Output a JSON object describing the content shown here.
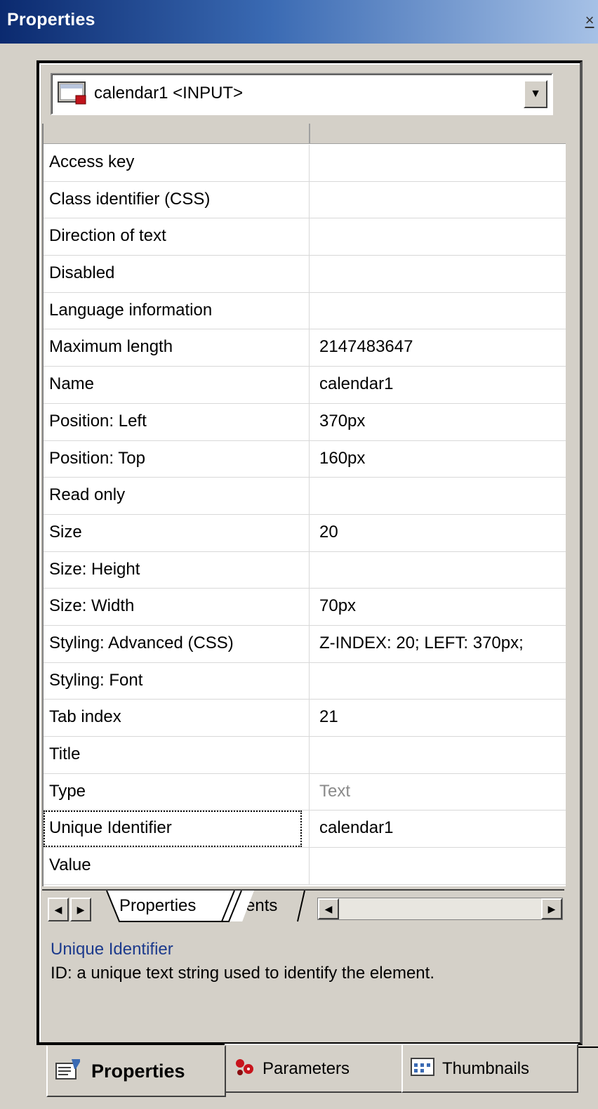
{
  "window": {
    "title": "Properties",
    "close_label": "×"
  },
  "object_selector": {
    "value": "calendar1 <INPUT>",
    "dropdown_arrow": "▼"
  },
  "properties": [
    {
      "name": "Access key",
      "value": ""
    },
    {
      "name": "Class identifier (CSS)",
      "value": ""
    },
    {
      "name": "Direction of text",
      "value": ""
    },
    {
      "name": "Disabled",
      "value": ""
    },
    {
      "name": "Language information",
      "value": ""
    },
    {
      "name": "Maximum length",
      "value": "2147483647"
    },
    {
      "name": "Name",
      "value": "calendar1"
    },
    {
      "name": "Position: Left",
      "value": "370px"
    },
    {
      "name": "Position: Top",
      "value": "160px"
    },
    {
      "name": "Read only",
      "value": ""
    },
    {
      "name": "Size",
      "value": "20"
    },
    {
      "name": "Size: Height",
      "value": ""
    },
    {
      "name": "Size: Width",
      "value": "70px"
    },
    {
      "name": "Styling: Advanced (CSS)",
      "value": "Z-INDEX: 20; LEFT: 370px;"
    },
    {
      "name": "Styling: Font",
      "value": ""
    },
    {
      "name": "Tab index",
      "value": "21"
    },
    {
      "name": "Title",
      "value": ""
    },
    {
      "name": "Type",
      "value": "Text"
    },
    {
      "name": "Unique Identifier",
      "value": "calendar1"
    },
    {
      "name": "Value",
      "value": ""
    }
  ],
  "focused_property": "Unique Identifier",
  "sheet_tabs": {
    "properties": "Properties",
    "events": "Events",
    "scroll_left": "◀",
    "scroll_right": "▶"
  },
  "description": {
    "title": "Unique Identifier",
    "text": "ID: a unique text string used to identify the element."
  },
  "bottom_tabs": {
    "properties": "Properties",
    "parameters": "Parameters",
    "thumbnails": "Thumbnails",
    "active": "properties"
  },
  "colors": {
    "titlebar_start": "#0b2a6f",
    "titlebar_end": "#a6c1e6",
    "description_title": "#1c3a8c",
    "disabled_value": "#8a8a8a"
  }
}
